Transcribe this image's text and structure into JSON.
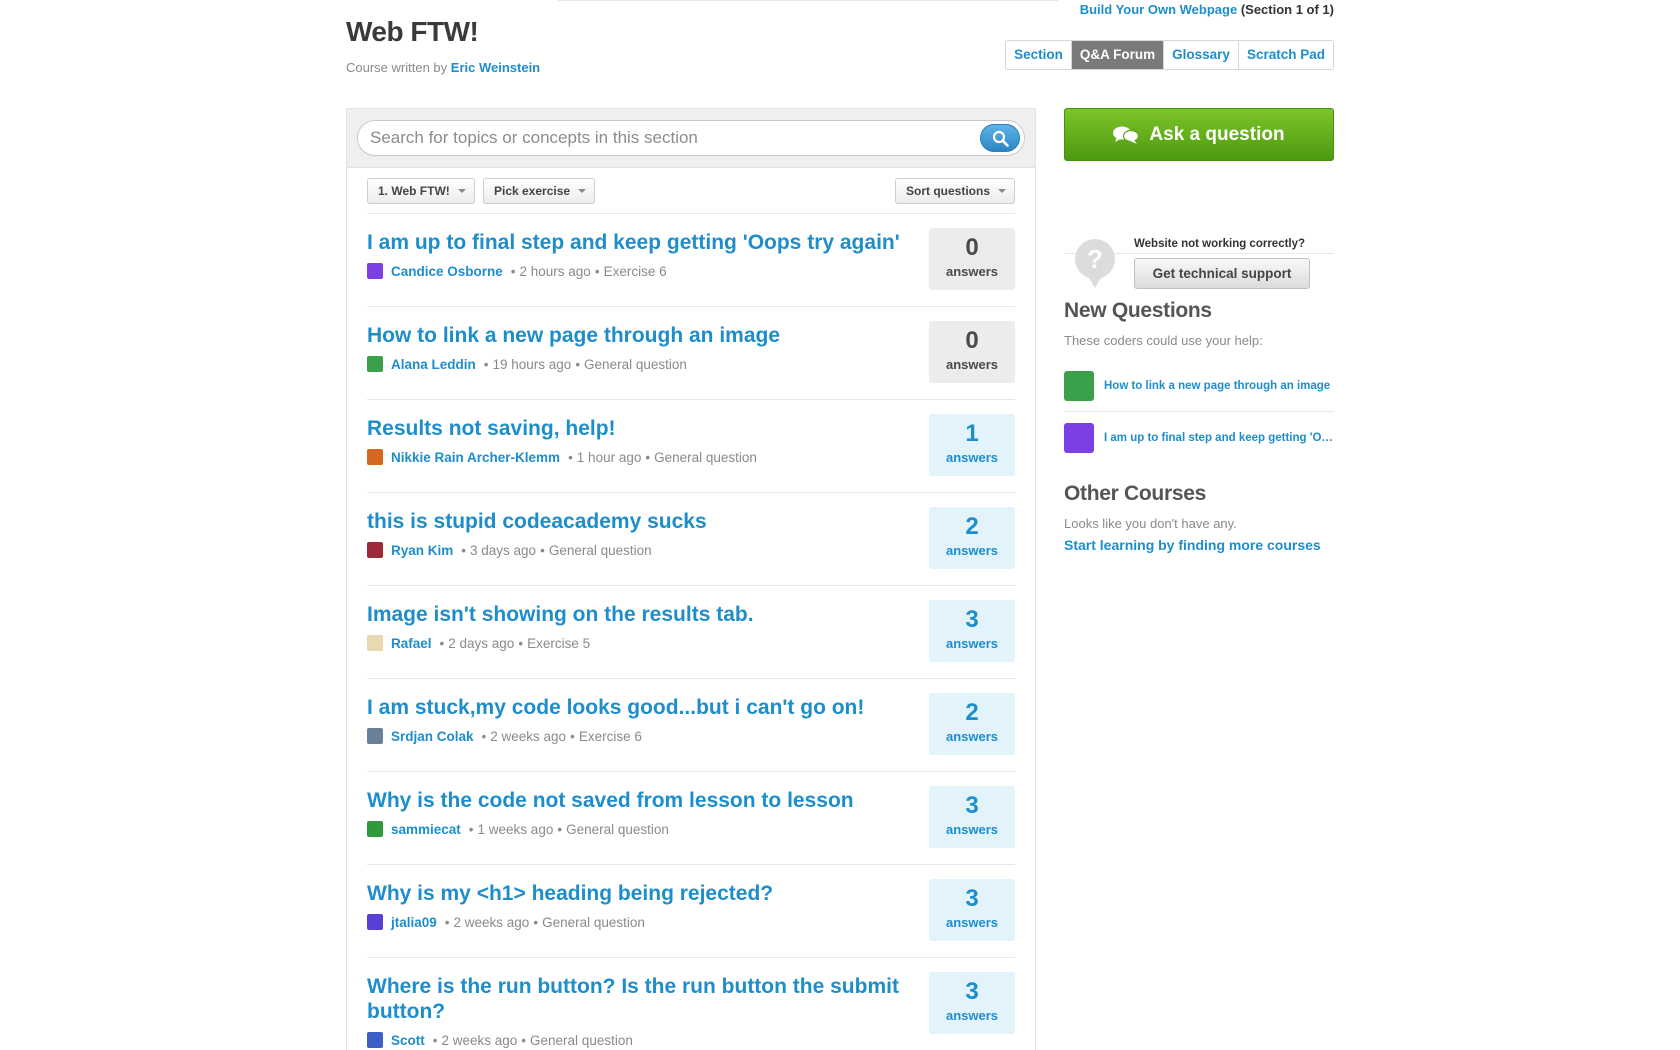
{
  "header": {
    "course_title": "Web FTW!",
    "byline_prefix": "Course written by",
    "author": "Eric Weinstein",
    "section_link": "Build Your Own Webpage",
    "section_suffix": "(Section 1 of 1)",
    "tabs": [
      {
        "label": "Section",
        "active": false
      },
      {
        "label": "Q&A Forum",
        "active": true
      },
      {
        "label": "Glossary",
        "active": false
      },
      {
        "label": "Scratch Pad",
        "active": false
      }
    ]
  },
  "search": {
    "placeholder": "Search for topics or concepts in this section",
    "icon": "search-icon"
  },
  "filters": {
    "section_select": "1. Web FTW!",
    "exercise_select": "Pick exercise",
    "sort_select": "Sort questions"
  },
  "questions": [
    {
      "title": "I am up to final step and keep getting 'Oops try again'",
      "author": "Candice Osborne",
      "time": "2 hours ago",
      "context": "Exercise 6",
      "answers": "0",
      "answers_label": "answers",
      "avatar_color": "#7b3fe4"
    },
    {
      "title": "How to link a new page through an image",
      "author": "Alana Leddin",
      "time": "19 hours ago",
      "context": "General question",
      "answers": "0",
      "answers_label": "answers",
      "avatar_color": "#3aa04a"
    },
    {
      "title": "Results not saving, help!",
      "author": "Nikkie Rain Archer-Klemm",
      "time": "1 hour ago",
      "context": "General question",
      "answers": "1",
      "answers_label": "answers",
      "avatar_color": "#d2691e"
    },
    {
      "title": "this is stupid codeacademy sucks",
      "author": "Ryan Kim",
      "time": "3 days ago",
      "context": "General question",
      "answers": "2",
      "answers_label": "answers",
      "avatar_color": "#9c2a3a"
    },
    {
      "title": "Image isn't showing on the results tab.",
      "author": "Rafael",
      "time": "2 days ago",
      "context": "Exercise 5",
      "answers": "3",
      "answers_label": "answers",
      "avatar_color": "#e8d9b0"
    },
    {
      "title": "I am stuck,my code looks good...but i can't go on!",
      "author": "Srdjan Colak",
      "time": "2 weeks ago",
      "context": "Exercise 6",
      "answers": "2",
      "answers_label": "answers",
      "avatar_color": "#6a7f99"
    },
    {
      "title": "Why is the code not saved from lesson to lesson",
      "author": "sammiecat",
      "time": "1 weeks ago",
      "context": "General question",
      "answers": "3",
      "answers_label": "answers",
      "avatar_color": "#2e9a3a"
    },
    {
      "title": "Why is my <h1> heading being rejected?",
      "author": "jtalia09",
      "time": "2 weeks ago",
      "context": "General question",
      "answers": "3",
      "answers_label": "answers",
      "avatar_color": "#5a3fd4"
    },
    {
      "title": "Where is the run button? Is the run button the submit button?",
      "author": "Scott",
      "time": "2 weeks ago",
      "context": "General question",
      "answers": "3",
      "answers_label": "answers",
      "avatar_color": "#3b5fc4"
    }
  ],
  "sidebar": {
    "ask_button": "Ask a question",
    "support_text": "Website not working correctly?",
    "support_button": "Get technical support",
    "new_questions_heading": "New Questions",
    "new_questions_sub": "These coders could use your help:",
    "new_questions": [
      {
        "title": "How to link a new page through an image",
        "avatar_color": "#3aa04a"
      },
      {
        "title": "I am up to final step and keep getting 'Oops try again'",
        "avatar_color": "#7b3fe4"
      }
    ],
    "other_courses_heading": "Other Courses",
    "other_courses_sub": "Looks like you don't have any.",
    "find_courses_link": "Start learning by finding more courses"
  }
}
